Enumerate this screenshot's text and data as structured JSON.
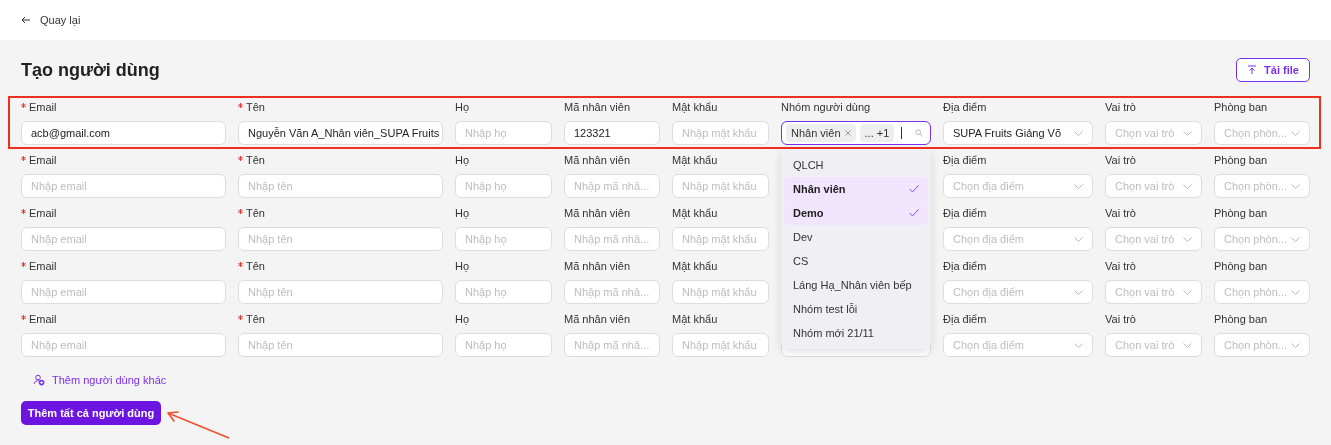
{
  "back_link": {
    "label": "Quay lại"
  },
  "title": "Tạo người dùng",
  "upload_button": {
    "label": "Tải file"
  },
  "rows": [
    {
      "highlighted": true,
      "fields": [
        {
          "kind": "input",
          "label": "Email",
          "required": true,
          "value": "acb@gmail.com"
        },
        {
          "kind": "input",
          "label": "Tên",
          "required": true,
          "value": "Nguyễn Văn A_Nhân viên_SUPA Fruits"
        },
        {
          "kind": "input",
          "label": "Họ",
          "required": false,
          "placeholder": "Nhập họ"
        },
        {
          "kind": "input",
          "label": "Mã nhân viên",
          "required": false,
          "value": "123321"
        },
        {
          "kind": "input",
          "label": "Mật khẩu",
          "required": false,
          "placeholder": "Nhập mật khẩu"
        },
        {
          "kind": "tags",
          "label": "Nhóm người dùng",
          "required": false,
          "focused": true,
          "tags": [
            {
              "text": "Nhân viên",
              "removable": true
            },
            {
              "text": "... +1",
              "removable": false
            }
          ]
        },
        {
          "kind": "select",
          "label": "Địa điểm",
          "required": false,
          "value": "SUPA Fruits Giảng Võ"
        },
        {
          "kind": "select",
          "label": "Vai trò",
          "required": false,
          "placeholder": "Chọn vai trò"
        },
        {
          "kind": "select",
          "label": "Phòng ban",
          "required": false,
          "placeholder": "Chọn phòn..."
        }
      ]
    },
    {
      "highlighted": false,
      "fields": [
        {
          "kind": "input",
          "label": "Email",
          "required": true,
          "placeholder": "Nhập email"
        },
        {
          "kind": "input",
          "label": "Tên",
          "required": true,
          "placeholder": "Nhập tên"
        },
        {
          "kind": "input",
          "label": "Họ",
          "required": false,
          "placeholder": "Nhập họ"
        },
        {
          "kind": "input",
          "label": "Mã nhân viên",
          "required": false,
          "placeholder": "Nhập mã nhâ..."
        },
        {
          "kind": "input",
          "label": "Mật khẩu",
          "required": false,
          "placeholder": "Nhập mật khẩu"
        },
        {
          "kind": "hidden"
        },
        {
          "kind": "select",
          "label": "Địa điểm",
          "required": false,
          "placeholder": "Chọn địa điểm"
        },
        {
          "kind": "select",
          "label": "Vai trò",
          "required": false,
          "placeholder": "Chọn vai trò"
        },
        {
          "kind": "select",
          "label": "Phòng ban",
          "required": false,
          "placeholder": "Chọn phòn..."
        }
      ]
    },
    {
      "highlighted": false,
      "fields": [
        {
          "kind": "input",
          "label": "Email",
          "required": true,
          "placeholder": "Nhập email"
        },
        {
          "kind": "input",
          "label": "Tên",
          "required": true,
          "placeholder": "Nhập tên"
        },
        {
          "kind": "input",
          "label": "Họ",
          "required": false,
          "placeholder": "Nhập họ"
        },
        {
          "kind": "input",
          "label": "Mã nhân viên",
          "required": false,
          "placeholder": "Nhập mã nhâ..."
        },
        {
          "kind": "input",
          "label": "Mật khẩu",
          "required": false,
          "placeholder": "Nhập mật khẩu"
        },
        {
          "kind": "hidden"
        },
        {
          "kind": "select",
          "label": "Địa điểm",
          "required": false,
          "placeholder": "Chọn địa điểm"
        },
        {
          "kind": "select",
          "label": "Vai trò",
          "required": false,
          "placeholder": "Chọn vai trò"
        },
        {
          "kind": "select",
          "label": "Phòng ban",
          "required": false,
          "placeholder": "Chọn phòn..."
        }
      ]
    },
    {
      "highlighted": false,
      "fields": [
        {
          "kind": "input",
          "label": "Email",
          "required": true,
          "placeholder": "Nhập email"
        },
        {
          "kind": "input",
          "label": "Tên",
          "required": true,
          "placeholder": "Nhập tên"
        },
        {
          "kind": "input",
          "label": "Họ",
          "required": false,
          "placeholder": "Nhập họ"
        },
        {
          "kind": "input",
          "label": "Mã nhân viên",
          "required": false,
          "placeholder": "Nhập mã nhâ..."
        },
        {
          "kind": "input",
          "label": "Mật khẩu",
          "required": false,
          "placeholder": "Nhập mật khẩu"
        },
        {
          "kind": "hidden"
        },
        {
          "kind": "select",
          "label": "Địa điểm",
          "required": false,
          "placeholder": "Chọn địa điểm"
        },
        {
          "kind": "select",
          "label": "Vai trò",
          "required": false,
          "placeholder": "Chọn vai trò"
        },
        {
          "kind": "select",
          "label": "Phòng ban",
          "required": false,
          "placeholder": "Chọn phòn..."
        }
      ]
    },
    {
      "highlighted": false,
      "fields": [
        {
          "kind": "input",
          "label": "Email",
          "required": true,
          "placeholder": "Nhập email"
        },
        {
          "kind": "input",
          "label": "Tên",
          "required": true,
          "placeholder": "Nhập tên"
        },
        {
          "kind": "input",
          "label": "Họ",
          "required": false,
          "placeholder": "Nhập họ"
        },
        {
          "kind": "input",
          "label": "Mã nhân viên",
          "required": false,
          "placeholder": "Nhập mã nhâ..."
        },
        {
          "kind": "input",
          "label": "Mật khẩu",
          "required": false,
          "placeholder": "Nhập mật khẩu"
        },
        {
          "kind": "covered"
        },
        {
          "kind": "select",
          "label": "Địa điểm",
          "required": false,
          "placeholder": "Chọn địa điểm"
        },
        {
          "kind": "select",
          "label": "Vai trò",
          "required": false,
          "placeholder": "Chọn vai trò"
        },
        {
          "kind": "select",
          "label": "Phòng ban",
          "required": false,
          "placeholder": "Chọn phòn..."
        }
      ]
    }
  ],
  "dropdown_options": [
    {
      "label": "QLCH",
      "selected": false
    },
    {
      "label": "Nhân viên",
      "selected": true
    },
    {
      "label": "Demo",
      "selected": true
    },
    {
      "label": "Dev",
      "selected": false
    },
    {
      "label": "CS",
      "selected": false
    },
    {
      "label": "Láng Hạ_Nhân viên bếp",
      "selected": false
    },
    {
      "label": "Nhóm test lỗi",
      "selected": false
    },
    {
      "label": "Nhóm mới 21/11",
      "selected": false
    }
  ],
  "add_another_link": {
    "label": "Thêm người dùng khác"
  },
  "submit_button": {
    "label": "Thêm tất cả người dùng"
  }
}
